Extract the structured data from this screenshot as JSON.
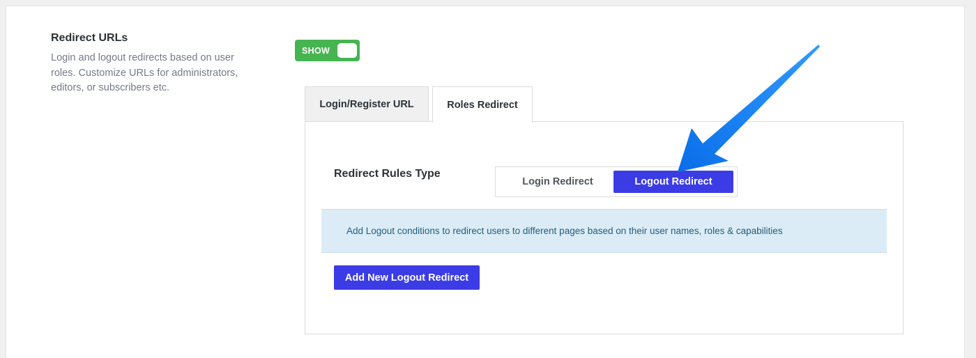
{
  "section": {
    "title": "Redirect URLs",
    "description": "Login and logout redirects based on user roles. Customize URLs for administrators, editors, or subscribers etc."
  },
  "toggle": {
    "label": "SHOW",
    "state": "on",
    "color": "#46b450"
  },
  "tabs": [
    {
      "label": "Login/Register URL",
      "active": false
    },
    {
      "label": "Roles Redirect",
      "active": true
    }
  ],
  "panel": {
    "rules_type_label": "Redirect Rules Type",
    "segments": [
      {
        "label": "Login Redirect",
        "selected": false
      },
      {
        "label": "Logout Redirect",
        "selected": true
      }
    ],
    "notice": "Add Logout conditions to redirect users to different pages based on their user names, roles & capabilities",
    "add_button": "Add New Logout Redirect"
  },
  "colors": {
    "accent": "#3c3ce6",
    "notice_bg": "#dcecf6",
    "annotation_arrow": "#1a86f5"
  },
  "annotation": {
    "icon": "arrow-pointer-icon"
  }
}
